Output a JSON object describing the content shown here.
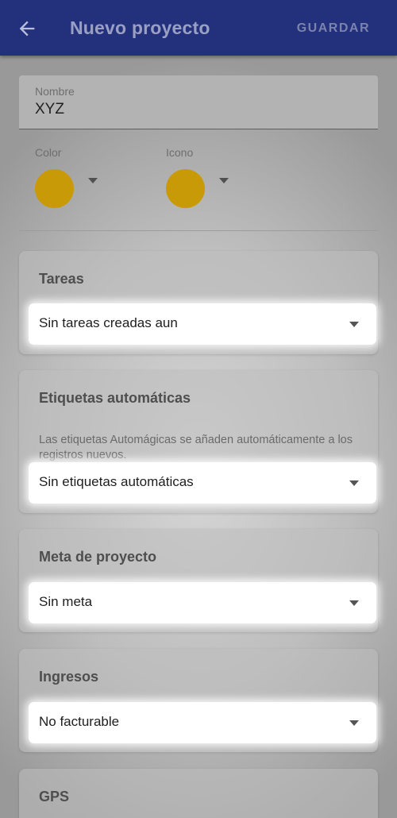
{
  "appbar": {
    "title": "Nuevo proyecto",
    "save_label": "GUARDAR",
    "back_icon": "arrow-left-icon"
  },
  "form": {
    "name_label": "Nombre",
    "name_value": "XYZ",
    "color_label": "Color",
    "icon_label": "Icono",
    "swatch_color": "#c89a08"
  },
  "sections": {
    "tareas": {
      "title": "Tareas",
      "value": "Sin tareas creadas aun"
    },
    "etiquetas": {
      "title": "Etiquetas automáticas",
      "description": "Las etiquetas Automágicas se añaden automáticamente a los registros nuevos.",
      "value": "Sin etiquetas automáticas"
    },
    "meta": {
      "title": "Meta de proyecto",
      "value": "Sin meta"
    },
    "ingresos": {
      "title": "Ingresos",
      "value": "No facturable"
    },
    "gps": {
      "title": "GPS"
    }
  }
}
